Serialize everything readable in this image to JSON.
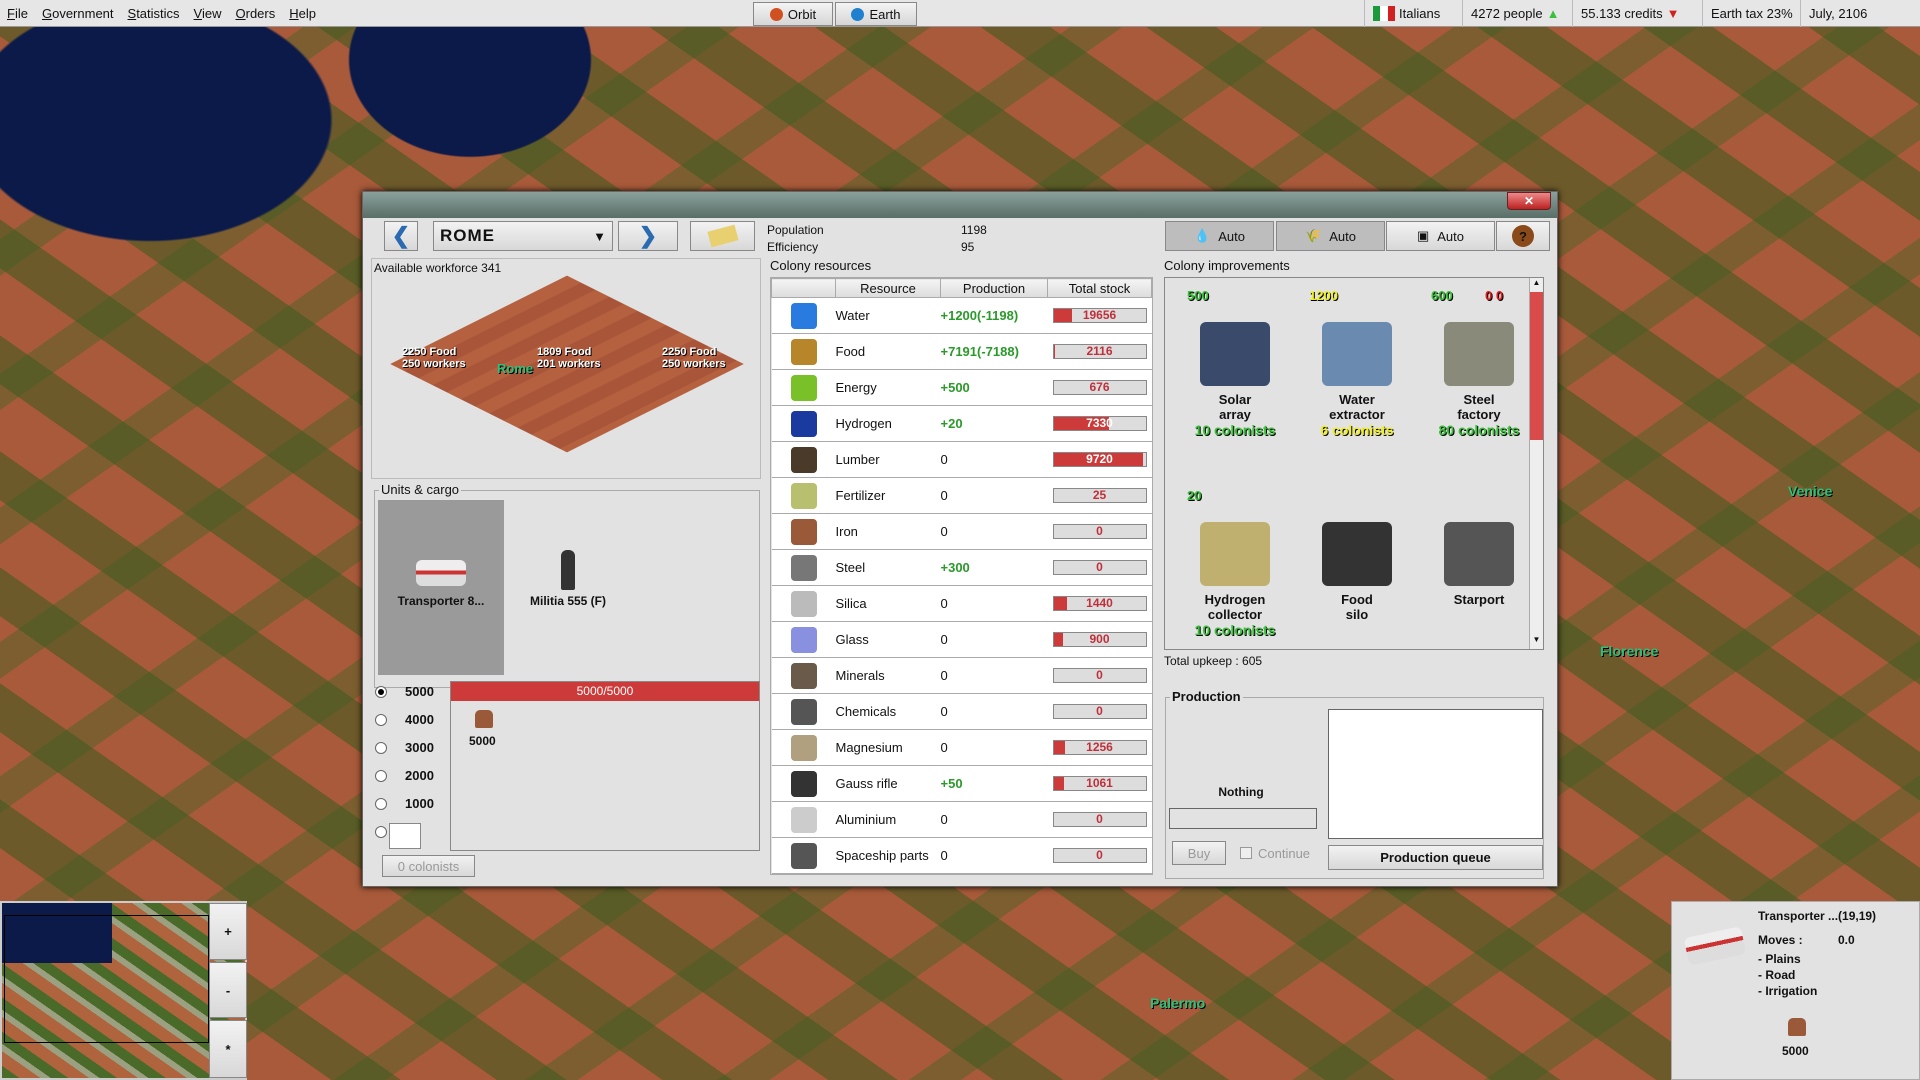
{
  "menu": [
    "File",
    "Government",
    "Statistics",
    "View",
    "Orders",
    "Help"
  ],
  "top": {
    "orbit": "Orbit",
    "earth": "Earth",
    "nation": "Italians",
    "people": "4272 people",
    "people_trend": "up",
    "credits": "55.133 credits",
    "credits_trend": "down",
    "tax": "Earth tax 23%",
    "date": "July, 2106"
  },
  "map_labels": {
    "venice": "Venice",
    "florence": "Florence",
    "palermo": "Palermo"
  },
  "colony": {
    "city": "ROME",
    "population_label": "Population",
    "population": "1198",
    "efficiency_label": "Efficiency",
    "efficiency": "95",
    "auto_buttons": [
      "Auto",
      "Auto",
      "Auto"
    ],
    "workforce": "Available workforce  341",
    "tiles": [
      {
        "line1": "2250 Food",
        "line2": "250 workers"
      },
      {
        "line1": "1809 Food",
        "line2": "201 workers"
      },
      {
        "line1": "2250 Food",
        "line2": "250 workers"
      }
    ],
    "city_label": "Rome"
  },
  "resources": {
    "title": "Colony resources",
    "headers": [
      "",
      "Resource",
      "Production",
      "Total stock"
    ],
    "rows": [
      {
        "name": "Water",
        "production": "+1200(-1198)",
        "stock": "19656",
        "fill": 0.2,
        "color": "#2a7be0"
      },
      {
        "name": "Food",
        "production": "+7191(-7188)",
        "stock": "2116",
        "fill": 0.02,
        "color": "#b8862a"
      },
      {
        "name": "Energy",
        "production": "+500",
        "stock": "676",
        "fill": 0,
        "color": "#7ac028"
      },
      {
        "name": "Hydrogen",
        "production": "+20",
        "stock": "7330",
        "fill": 0.6,
        "color": "#1a3aa0"
      },
      {
        "name": "Lumber",
        "production": "0",
        "stock": "9720",
        "fill": 0.97,
        "color": "#4a3a2a"
      },
      {
        "name": "Fertilizer",
        "production": "0",
        "stock": "25",
        "fill": 0,
        "color": "#b8c070"
      },
      {
        "name": "Iron",
        "production": "0",
        "stock": "0",
        "fill": 0,
        "color": "#9a5a3a"
      },
      {
        "name": "Steel",
        "production": "+300",
        "stock": "0",
        "fill": 0,
        "color": "#777"
      },
      {
        "name": "Silica",
        "production": "0",
        "stock": "1440",
        "fill": 0.15,
        "color": "#bbb"
      },
      {
        "name": "Glass",
        "production": "0",
        "stock": "900",
        "fill": 0.1,
        "color": "#8a90e0"
      },
      {
        "name": "Minerals",
        "production": "0",
        "stock": "0",
        "fill": 0,
        "color": "#6a5a4a"
      },
      {
        "name": "Chemicals",
        "production": "0",
        "stock": "0",
        "fill": 0,
        "color": "#555"
      },
      {
        "name": "Magnesium",
        "production": "0",
        "stock": "1256",
        "fill": 0.13,
        "color": "#b0a080"
      },
      {
        "name": "Gauss rifle",
        "production": "+50",
        "stock": "1061",
        "fill": 0.11,
        "color": "#333"
      },
      {
        "name": "Aluminium",
        "production": "0",
        "stock": "0",
        "fill": 0,
        "color": "#ccc"
      },
      {
        "name": "Spaceship parts",
        "production": "0",
        "stock": "0",
        "fill": 0,
        "color": "#555"
      }
    ]
  },
  "improvements": {
    "title": "Colony improvements",
    "items": [
      {
        "num": "500",
        "num_color": "#3ac03a",
        "name1": "Solar",
        "name2": "array",
        "colonists": "10 colonists",
        "col_color": "#3ac03a",
        "pic": "#3a4a6a"
      },
      {
        "num": "1200",
        "num_color": "#f0f020",
        "name1": "Water",
        "name2": "extractor",
        "colonists": "6 colonists",
        "col_color": "#f0f020",
        "pic": "#6a8ab0"
      },
      {
        "num": "600",
        "num_color": "#3ac03a",
        "extra": "0  0",
        "name1": "Steel",
        "name2": "factory",
        "colonists": "80 colonists",
        "col_color": "#3ac03a",
        "pic": "#8a8a7a"
      },
      {
        "num": "20",
        "num_color": "#3ac03a",
        "name1": "Hydrogen",
        "name2": "collector",
        "colonists": "10 colonists",
        "col_color": "#3ac03a",
        "pic": "#c0b070"
      },
      {
        "name1": "Food",
        "name2": "silo",
        "pic": "#333"
      },
      {
        "name1": "Starport",
        "name2": "",
        "pic": "#555"
      }
    ],
    "upkeep": "Total upkeep : 605"
  },
  "production": {
    "title": "Production",
    "current": "Nothing",
    "buy": "Buy",
    "continue": "Continue",
    "queue": "Production queue"
  },
  "units": {
    "title": "Units & cargo",
    "items": [
      "Transporter 8...",
      "Militia 555 (F)"
    ],
    "amounts": [
      "5000",
      "4000",
      "3000",
      "2000",
      "1000"
    ],
    "selected_amount": "5000",
    "capacity": "5000/5000",
    "cargo_amount": "5000",
    "colonists_button": "0 colonists"
  },
  "minimap": {
    "zoom_in": "+",
    "zoom_out": "-",
    "center": "*"
  },
  "unit_info": {
    "title": "Transporter ...(19,19)",
    "moves_label": "Moves :",
    "moves": "0.0",
    "terrain": [
      "- Plains",
      "- Road",
      "- Irrigation"
    ],
    "cargo": "5000"
  }
}
